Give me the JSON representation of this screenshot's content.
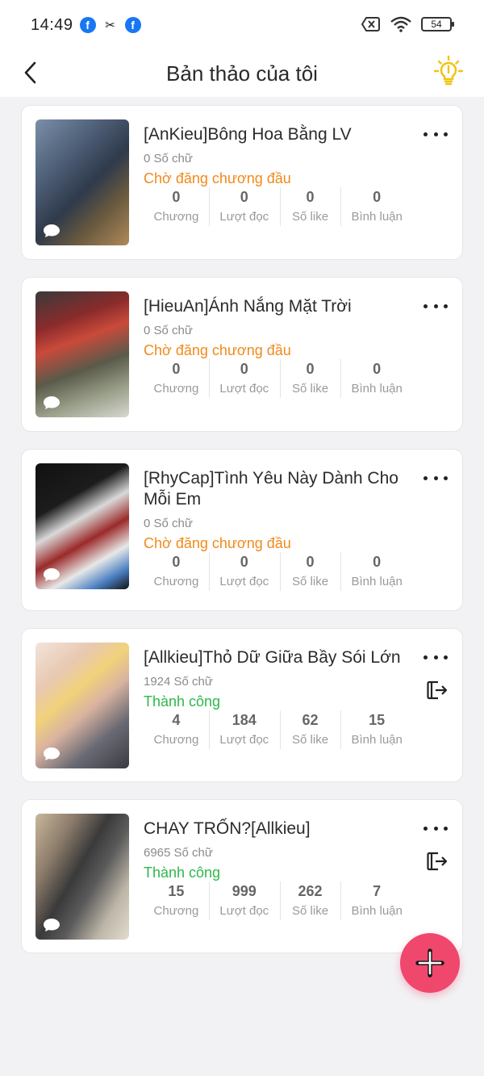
{
  "status_bar": {
    "time": "14:49",
    "battery": "54"
  },
  "header": {
    "title": "Bản thảo của tôi"
  },
  "colors": {
    "pending": "#f08a1c",
    "success": "#2db84b",
    "fab": "#f0476d"
  },
  "stat_labels": [
    "Chương",
    "Lượt đọc",
    "Số like",
    "Bình luận"
  ],
  "drafts": [
    {
      "title": "[AnKieu]Bông Hoa Bằng LV",
      "word_count": "0 Số chữ",
      "status": "Chờ đăng chương đầu",
      "chapters": "0",
      "reads": "0",
      "likes": "0",
      "comments": "0"
    },
    {
      "title": "[HieuAn]Ánh Nắng Mặt Trời",
      "word_count": "0 Số chữ",
      "status": "Chờ đăng chương đầu",
      "chapters": "0",
      "reads": "0",
      "likes": "0",
      "comments": "0"
    },
    {
      "title": "[RhyCap]Tình Yêu Này Dành Cho Mỗi Em",
      "word_count": "0 Số chữ",
      "status": "Chờ đăng chương đầu",
      "chapters": "0",
      "reads": "0",
      "likes": "0",
      "comments": "0"
    },
    {
      "title": "[Allkieu]Thỏ Dữ Giữa Bầy Sói Lớn",
      "word_count": "1924 Số chữ",
      "status": "Thành công",
      "chapters": "4",
      "reads": "184",
      "likes": "62",
      "comments": "15"
    },
    {
      "title": "CHAY TRỐN?[Allkieu]",
      "word_count": "6965 Số chữ",
      "status": "Thành công",
      "chapters": "15",
      "reads": "999",
      "likes": "262",
      "comments": "7"
    }
  ]
}
